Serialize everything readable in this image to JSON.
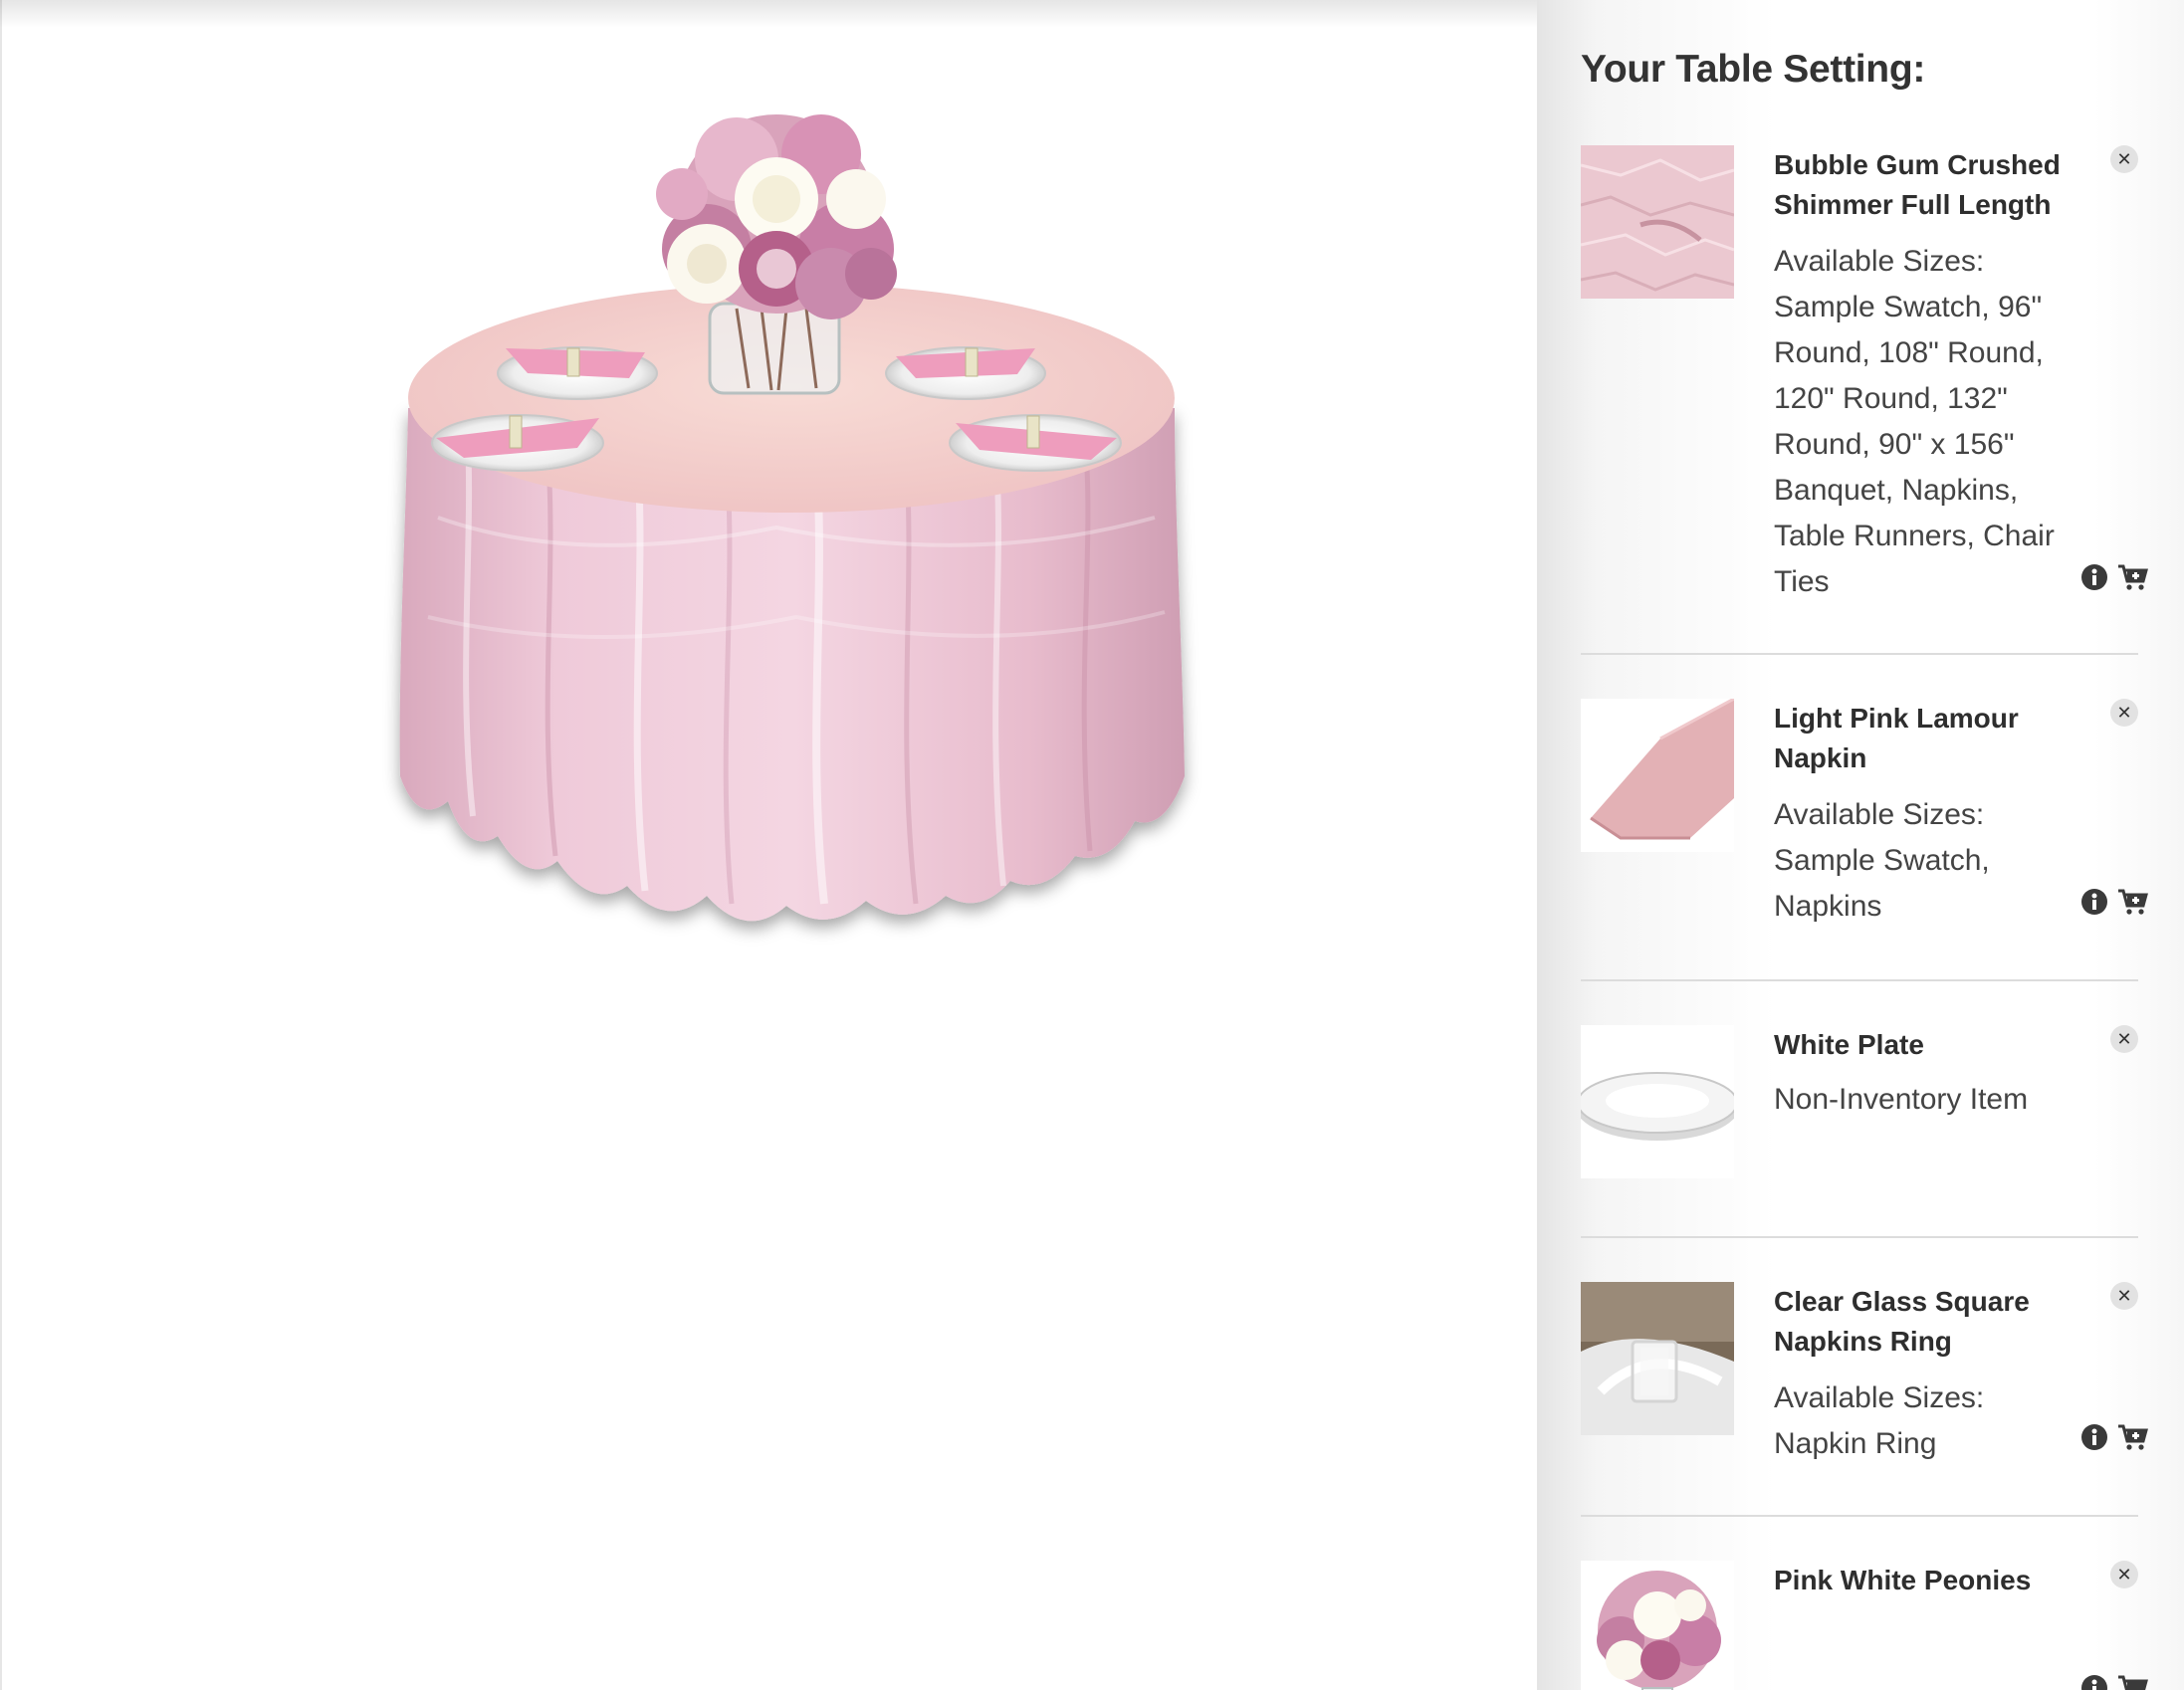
{
  "panel": {
    "title": "Your Table Setting:"
  },
  "items": [
    {
      "name": "Bubble Gum Crushed Shimmer Full Length",
      "sizes": "Available Sizes: Sample Swatch, 96\" Round, 108\" Round, 120\" Round, 132\" Round, 90\" x 156\" Banquet, Napkins, Table Runners, Chair Ties",
      "thumb": "pink-crushed-fabric"
    },
    {
      "name": "Light Pink Lamour Napkin",
      "sizes": "Available Sizes: Sample Swatch, Napkins",
      "thumb": "pink-folded-napkin"
    },
    {
      "name": "White Plate",
      "sizes": "Non-Inventory Item",
      "thumb": "white-plate"
    },
    {
      "name": "Clear Glass Square Napkins Ring",
      "sizes": "Available Sizes: Napkin Ring",
      "thumb": "glass-napkin-ring"
    },
    {
      "name": "Pink White Peonies",
      "sizes": "",
      "thumb": "pink-white-peonies"
    }
  ],
  "colors": {
    "tablecloth": "#e9b9cf",
    "tabletop": "#f4cdd0",
    "napkin": "#ee9dbd",
    "icon": "#3a3a3a",
    "divider": "#dcdcdc"
  }
}
